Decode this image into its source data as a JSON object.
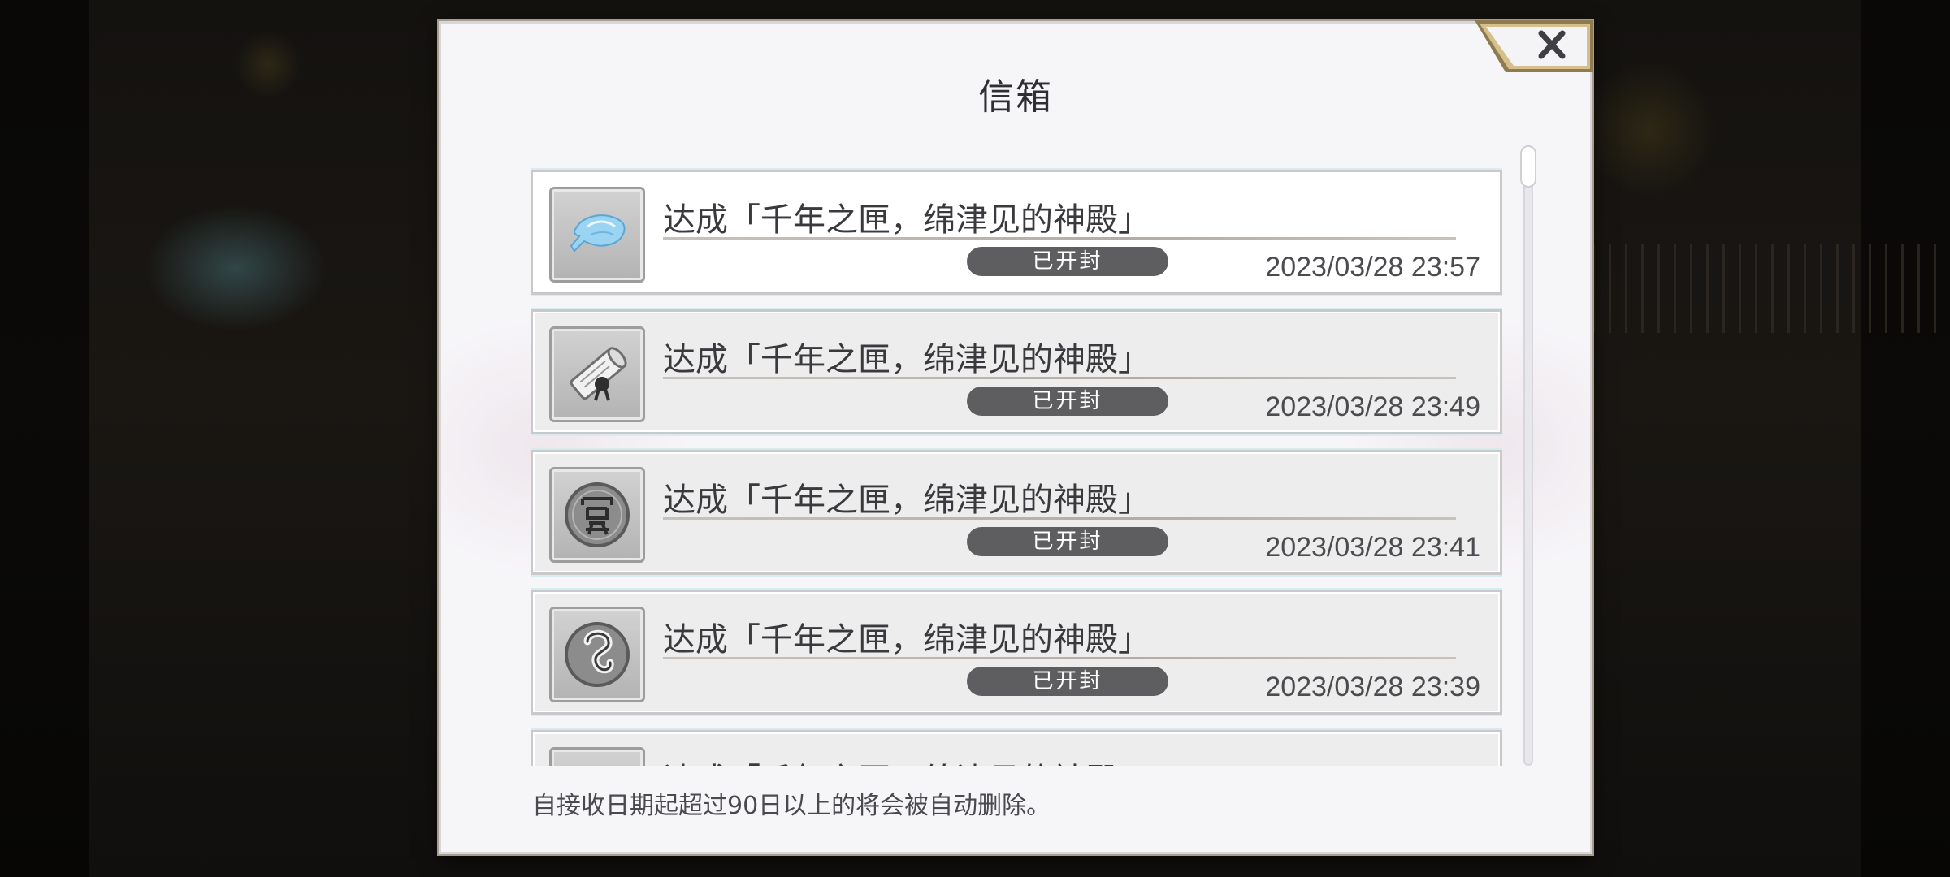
{
  "dialog": {
    "title": "信箱",
    "close_icon": "close-x-icon",
    "footer_note": "自接收日期起超过90日以上的将会被自动删除。"
  },
  "mail_list": [
    {
      "icon": "blue-crystal-fish-icon",
      "title": "达成「千年之匣，绵津见的神殿」",
      "status": "已开封",
      "date": "2023/03/28 23:57"
    },
    {
      "icon": "scroll-icon",
      "title": "达成「千年之匣，绵津见的神殿」",
      "status": "已开封",
      "date": "2023/03/28 23:49"
    },
    {
      "icon": "coin-emblem-icon",
      "title": "达成「千年之匣，绵津见的神殿」",
      "status": "已开封",
      "date": "2023/03/28 23:41"
    },
    {
      "icon": "hook-emblem-icon",
      "title": "达成「千年之匣，绵津见的神殿」",
      "status": "已开封",
      "date": "2023/03/28 23:39"
    },
    {
      "icon": "scroll-icon",
      "title": "达成「千年之匣，绵津见的神殿」",
      "status": "",
      "date": ""
    }
  ],
  "colors": {
    "dialog_bg": "#f6f5f8",
    "status_pill": "#5e5e60",
    "close_gold": "#c9ab6a"
  }
}
